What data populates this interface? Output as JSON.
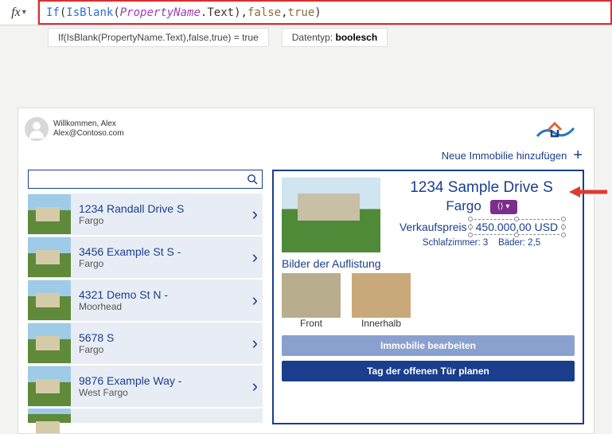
{
  "formula": {
    "prefix": "fx",
    "text_full": "If(IsBlank(PropertyName.Text),false,true)",
    "parts": {
      "if": "If",
      "isblank": "IsBlank",
      "prop": "PropertyName",
      "text": ".Text",
      "false": "false",
      "true": "true"
    }
  },
  "eval": {
    "expr": "If(IsBlank(PropertyName.Text),false,true)  =  true",
    "datatype_label": "Datentyp:",
    "datatype_value": "boolesch"
  },
  "user": {
    "welcome": "Willkommen, Alex",
    "email": "Alex@Contoso.com"
  },
  "add_label": "Neue Immobilie hinzufügen",
  "search_placeholder": "",
  "gallery": [
    {
      "title": "1234 Randall Drive S",
      "sub": "Fargo"
    },
    {
      "title": "3456 Example St S -",
      "sub": "Fargo"
    },
    {
      "title": "4321 Demo St N -",
      "sub": "Moorhead"
    },
    {
      "title": "5678 S",
      "sub": "Fargo"
    },
    {
      "title": "9876 Example Way -",
      "sub": "West Fargo"
    }
  ],
  "detail": {
    "title": "1234 Sample Drive S",
    "subtitle": "Fargo",
    "price_label": "Verkaufspreis",
    "price_value": "450.000,00 USD",
    "beds_label": "Schlafzimmer:",
    "beds_value": "3",
    "baths_label": "Bäder:",
    "baths_value": "2,5",
    "images_label": "Bilder der Auflistung",
    "img1_caption": "Front",
    "img2_caption": "Innerhalb",
    "btn_edit": "Immobilie bearbeiten",
    "btn_plan": "Tag der offenen Tür planen"
  }
}
